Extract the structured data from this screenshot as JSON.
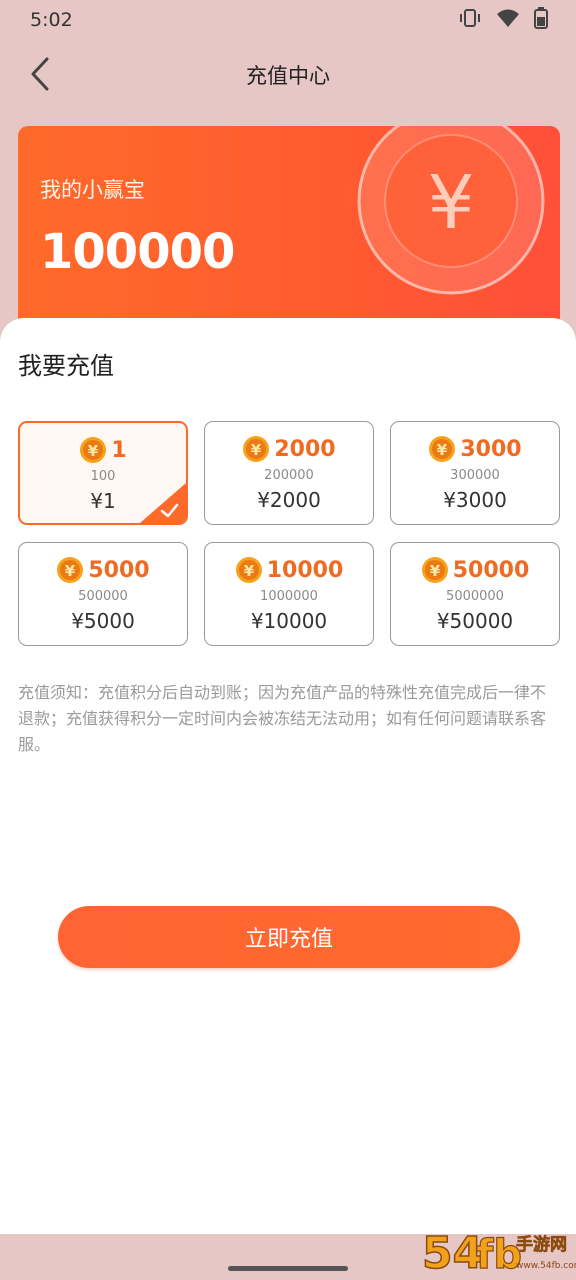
{
  "status": {
    "time": "5:02"
  },
  "icons": {
    "vibrate": "vibrate-icon",
    "wifi": "wifi-icon",
    "battery": "battery-icon",
    "back": "chevron-left-icon",
    "coin": "yuan-coin-icon",
    "check": "checkmark-icon"
  },
  "header": {
    "title": "充值中心"
  },
  "balance": {
    "label": "我的小赢宝",
    "value": "100000",
    "currency_symbol": "¥"
  },
  "recharge": {
    "title": "我要充值",
    "options": [
      {
        "coins": "1",
        "points": "100",
        "price": "¥1",
        "selected": true
      },
      {
        "coins": "2000",
        "points": "200000",
        "price": "¥2000",
        "selected": false
      },
      {
        "coins": "3000",
        "points": "300000",
        "price": "¥3000",
        "selected": false
      },
      {
        "coins": "5000",
        "points": "500000",
        "price": "¥5000",
        "selected": false
      },
      {
        "coins": "10000",
        "points": "1000000",
        "price": "¥10000",
        "selected": false
      },
      {
        "coins": "50000",
        "points": "5000000",
        "price": "¥50000",
        "selected": false
      }
    ],
    "notice": "充值须知：充值积分后自动到账；因为充值产品的特殊性充值完成后一律不退款；充值获得积分一定时间内会被冻结无法动用；如有任何问题请联系客服。",
    "button_label": "立即充值"
  },
  "watermark": {
    "text": "54fb手游网",
    "subtext": "www.54fb.com"
  },
  "colors": {
    "accent": "#ff6a2a",
    "page_bg": "#e6c7c6",
    "coin_gold": "#f7a21b",
    "coin_value": "#f06a22"
  }
}
